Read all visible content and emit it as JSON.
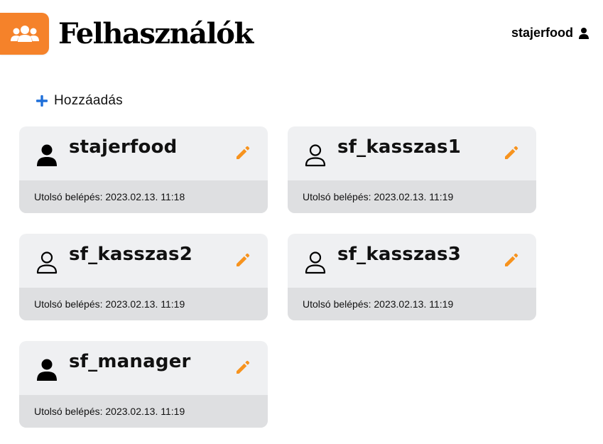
{
  "header": {
    "title": "Felhasználók",
    "icon": "users-icon",
    "accent_color": "#f5822a"
  },
  "user_menu": {
    "username": "stajerfood",
    "icon": "user-icon"
  },
  "add_button": {
    "label": "Hozzáadás",
    "icon": "plus-icon",
    "icon_color": "#1e6fd9"
  },
  "users": [
    {
      "name": "stajerfood",
      "avatar": "user-solid-icon",
      "last_login": "Utolsó belépés: 2023.02.13. 11:18"
    },
    {
      "name": "sf_kasszas1",
      "avatar": "user-outline-icon",
      "last_login": "Utolsó belépés: 2023.02.13. 11:19"
    },
    {
      "name": "sf_kasszas2",
      "avatar": "user-outline-icon",
      "last_login": "Utolsó belépés: 2023.02.13. 11:19"
    },
    {
      "name": "sf_kasszas3",
      "avatar": "user-outline-icon",
      "last_login": "Utolsó belépés: 2023.02.13. 11:19"
    },
    {
      "name": "sf_manager",
      "avatar": "user-solid-icon",
      "last_login": "Utolsó belépés: 2023.02.13. 11:19"
    }
  ],
  "edit_icon_color": "#f7931e"
}
